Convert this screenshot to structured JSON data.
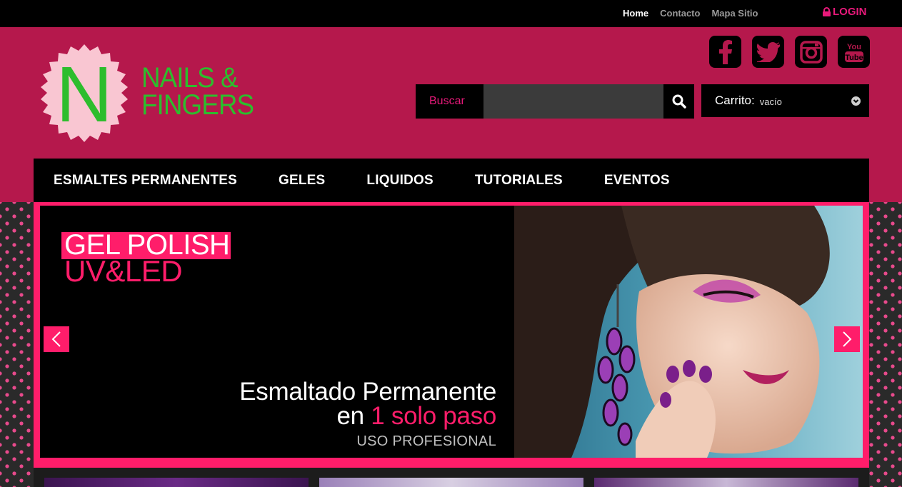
{
  "topbar": {
    "links": [
      {
        "label": "Home",
        "active": true
      },
      {
        "label": "Contacto",
        "active": false
      },
      {
        "label": "Mapa Sitio",
        "active": false
      }
    ],
    "login_label": "LOGIN",
    "login_icon": "lock-icon"
  },
  "logo": {
    "letter": "N",
    "line1": "NAILS &",
    "line2": "FINGERS",
    "colors": {
      "badge": "#f9c6d2",
      "text": "#2dbd2d"
    }
  },
  "social": [
    {
      "name": "facebook-icon",
      "glyph": "f"
    },
    {
      "name": "twitter-icon",
      "glyph": "bird"
    },
    {
      "name": "instagram-icon",
      "glyph": "camera"
    },
    {
      "name": "youtube-icon",
      "glyph": "You Tube"
    }
  ],
  "search": {
    "label": "Buscar",
    "placeholder": "",
    "value": "",
    "button_icon": "search-icon"
  },
  "cart": {
    "label": "Carrito:",
    "value": "vacío",
    "icon": "chevron-down-icon"
  },
  "nav": {
    "items": [
      "ESMALTES PERMANENTES",
      "GELES",
      "LIQUIDOS",
      "TUTORIALES",
      "EVENTOS"
    ]
  },
  "slider": {
    "title_line1": "GEL POLISH",
    "title_line2": "UV&LED",
    "copy_line1": "Esmaltado Permanente",
    "copy_line2_prefix": "en ",
    "copy_line2_highlight": "1 solo paso",
    "copy_line3": "USO PROFESIONAL",
    "prev_icon": "chevron-left-icon",
    "next_icon": "chevron-right-icon",
    "colors": {
      "accent": "#ff1d6a",
      "header": "#b5184c"
    }
  }
}
